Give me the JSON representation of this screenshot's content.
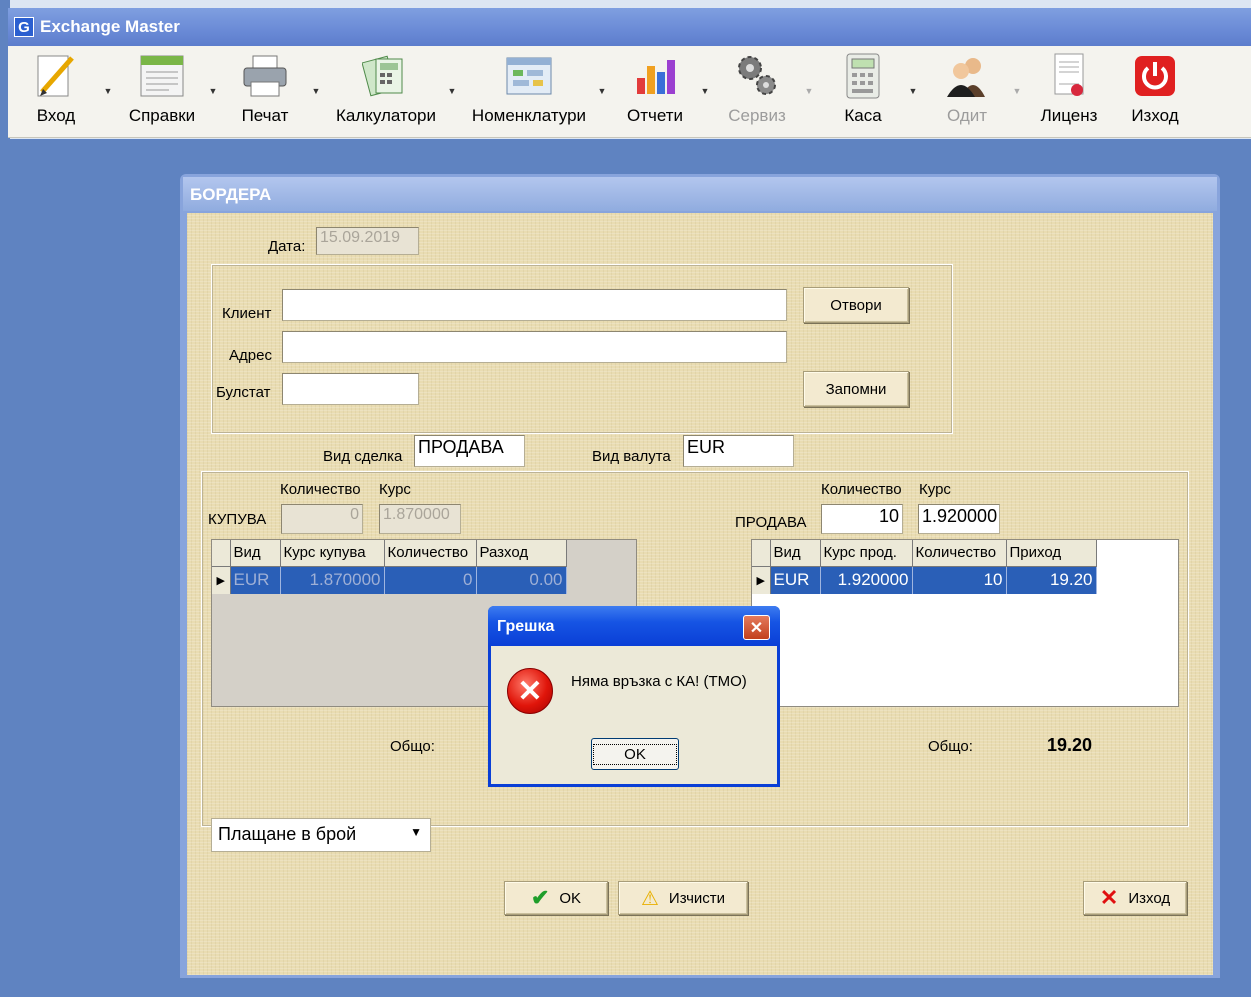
{
  "app": {
    "title": "Exchange Master",
    "logo_letter": "G"
  },
  "toolbar": [
    {
      "label": "Вход",
      "icon": "pencil-icon",
      "enabled": true,
      "dropdown": true
    },
    {
      "label": "Справки",
      "icon": "report-sheet-icon",
      "enabled": true,
      "dropdown": true
    },
    {
      "label": "Печат",
      "icon": "printer-icon",
      "enabled": true,
      "dropdown": true
    },
    {
      "label": "Калкулатори",
      "icon": "calculator-docs-icon",
      "enabled": true,
      "dropdown": true
    },
    {
      "label": "Номенклатури",
      "icon": "window-grid-icon",
      "enabled": true,
      "dropdown": true
    },
    {
      "label": "Отчети",
      "icon": "bar-chart-icon",
      "enabled": true,
      "dropdown": true
    },
    {
      "label": "Сервиз",
      "icon": "gears-icon",
      "enabled": false,
      "dropdown": true
    },
    {
      "label": "Каса",
      "icon": "cash-register-icon",
      "enabled": true,
      "dropdown": true
    },
    {
      "label": "Одит",
      "icon": "users-icon",
      "enabled": false,
      "dropdown": true
    },
    {
      "label": "Лиценз",
      "icon": "license-icon",
      "enabled": true,
      "dropdown": false
    },
    {
      "label": "Изход",
      "icon": "power-icon",
      "enabled": true,
      "dropdown": false
    }
  ],
  "form": {
    "title": "БОРДЕРА",
    "date_label": "Дата:",
    "date_value": "15.09.2019",
    "client_label": "Клиент",
    "client_value": "",
    "address_label": "Адрес",
    "address_value": "",
    "bulstat_label": "Булстат",
    "bulstat_value": "",
    "open_button": "Отвори",
    "save_button": "Запомни",
    "deal_type_label": "Вид сделка",
    "deal_type_value": "ПРОДАВА",
    "currency_label": "Вид валута",
    "currency_value": "EUR",
    "buy": {
      "section_label": "КУПУВА",
      "qty_header": "Количество",
      "rate_header": "Курс",
      "qty_value": "0",
      "rate_value": "1.870000",
      "columns": [
        "Вид",
        "Курс купува",
        "Количество",
        "Разход"
      ],
      "rows": [
        [
          "EUR",
          "1.870000",
          "0",
          "0.00"
        ]
      ],
      "total_label": "Общо:"
    },
    "sell": {
      "section_label": "ПРОДАВА",
      "qty_header": "Количество",
      "rate_header": "Курс",
      "qty_value": "10",
      "rate_value": "1.920000",
      "columns": [
        "Вид",
        "Курс прод.",
        "Количество",
        "Приход"
      ],
      "rows": [
        [
          "EUR",
          "1.920000",
          "10",
          "19.20"
        ]
      ],
      "total_label": "Общо:",
      "total_value": "19.20"
    },
    "payment_select": "Плащане в брой",
    "ok_button": "OK",
    "clear_button": "Изчисти",
    "exit_button": "Изход"
  },
  "dialog": {
    "title": "Грешка",
    "message": "Няма връзка с КА! (TMO)",
    "ok_button": "OK"
  },
  "colors": {
    "workspace": "#5f83c1",
    "form_background": "#e9dcb2",
    "selection": "#2a5fb7",
    "dialog_title": "#0a3fd6",
    "error_red": "#e0150a"
  }
}
